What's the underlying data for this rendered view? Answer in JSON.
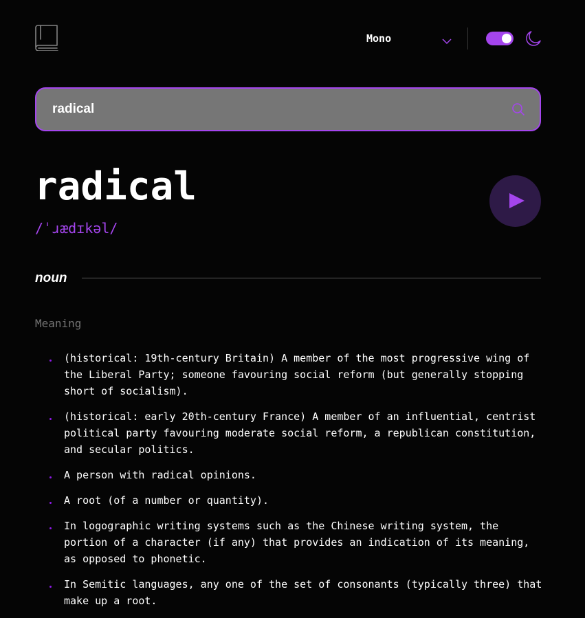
{
  "header": {
    "logo_icon": "book-icon",
    "font_selector": {
      "selected": "Mono",
      "icon": "chevron-down-icon"
    },
    "theme_toggle": {
      "state": "dark",
      "icon": "moon-icon"
    }
  },
  "search": {
    "value": "radical",
    "placeholder": "",
    "icon": "search-icon"
  },
  "entry": {
    "word": "radical",
    "phonetic": "/ˈɹædɪkəl/",
    "play_icon": "play-icon",
    "part_of_speech": "noun",
    "meaning_label": "Meaning",
    "definitions": [
      "(historical: 19th-century Britain) A member of the most progressive wing of the Liberal Party; someone favouring social reform (but generally stopping short of socialism).",
      "(historical: early 20th-century France) A member of an influential, centrist political party favouring moderate social reform, a republican constitution, and secular politics.",
      "A person with radical opinions.",
      "A root (of a number or quantity).",
      "In logographic writing systems such as the Chinese writing system, the portion of a character (if any) that provides an indication of its meaning, as opposed to phonetic.",
      "In Semitic languages, any one of the set of consonants (typically three) that make up a root."
    ]
  },
  "colors": {
    "accent": "#a445ed",
    "background": "#050505",
    "search_bg": "#767676",
    "muted": "#757575"
  }
}
